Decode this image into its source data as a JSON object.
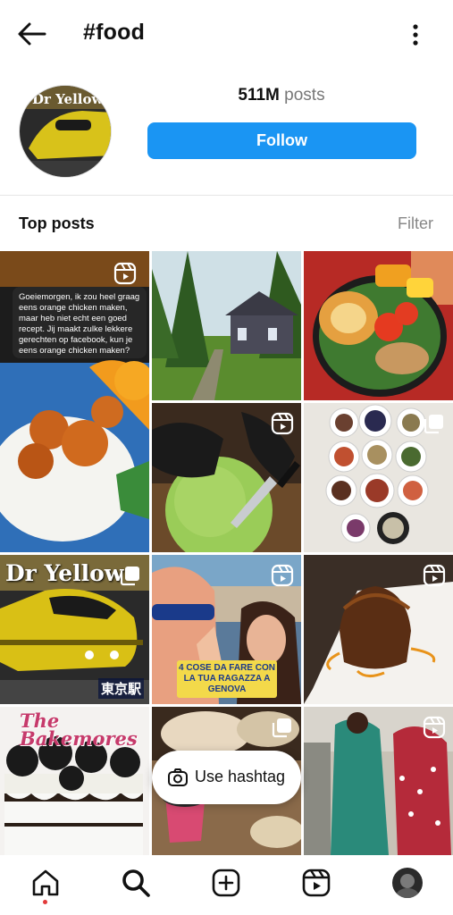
{
  "app_bar": {
    "title": "#food",
    "back_icon": "arrow-left-icon",
    "more_icon": "more-vertical-icon"
  },
  "header": {
    "posts_count": "511M",
    "posts_word": "posts",
    "follow_label": "Follow",
    "avatar_text": "Dr Yellow"
  },
  "section": {
    "title": "Top posts",
    "filter_label": "Filter"
  },
  "posts": [
    {
      "id": "post-orange-chicken",
      "badge": "reels-icon",
      "caption": "Goeiemorgen, ik zou heel graag eens orange chicken maken, maar heb niet echt een goed recept. Jij maakt zulke lekkere gerechten op facebook, kun je eens orange chicken maken?"
    },
    {
      "id": "post-cabin-garden",
      "badge": ""
    },
    {
      "id": "post-bento",
      "badge": ""
    },
    {
      "id": "post-melon-knife",
      "badge": "reels-icon"
    },
    {
      "id": "post-korean-dishes",
      "badge": "multiple-icon"
    },
    {
      "id": "post-dr-yellow-train",
      "badge": "multiple-icon",
      "overlay_title": "Dr Yellow",
      "overlay_station": "東京駅"
    },
    {
      "id": "post-genova",
      "badge": "reels-icon",
      "overlay_text": "4 COSE DA FARE CON LA TUA RAGAZZA A GENOVA"
    },
    {
      "id": "post-chocolate-dessert",
      "badge": "reels-icon"
    },
    {
      "id": "post-oreo-cake",
      "badge": "",
      "overlay_text": "The Bakemores"
    },
    {
      "id": "post-cupcakes",
      "badge": "multiple-icon"
    },
    {
      "id": "post-dancing",
      "badge": "reels-icon"
    }
  ],
  "use_hashtag": {
    "label": "Use hashtag",
    "icon": "camera-icon"
  },
  "bottom_nav": {
    "items": [
      "home-icon",
      "search-icon",
      "new-post-icon",
      "reels-icon",
      "profile-avatar"
    ],
    "active": "home-icon"
  },
  "colors": {
    "follow_blue": "#1a95f3",
    "filter_gray": "#888888",
    "nav_dot": "#e23a3a"
  }
}
